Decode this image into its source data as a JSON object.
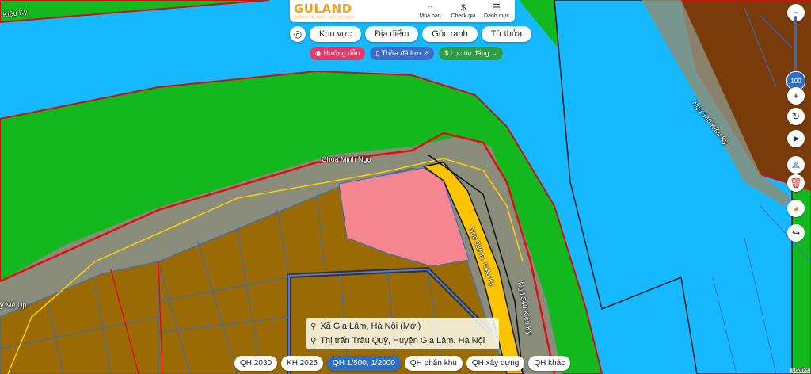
{
  "header": {
    "logo_text": "GULAND",
    "logo_sub": "THÔNG TIN THẬT · GIÁ TRỊ THẬT",
    "actions": [
      {
        "label": "Mua bán",
        "icon": "house-icon"
      },
      {
        "label": "Check giá",
        "icon": "dollar-icon"
      },
      {
        "label": "Danh mục",
        "icon": "menu-icon"
      }
    ]
  },
  "search_tabs": [
    "Khu vực",
    "Địa điểm",
    "Góc ranh",
    "Tờ thửa"
  ],
  "chips": {
    "guide": "Hướng dẫn",
    "saved": "Thửa đã lưu",
    "filter": "Lọc tin đăng"
  },
  "side": {
    "zoom_level": "100",
    "buttons": [
      "plus-icon",
      "refresh-icon",
      "navigate-icon",
      "measure-icon",
      "trash-icon",
      "palette-icon",
      "share-icon"
    ]
  },
  "map_labels": {
    "pagoda": "Chùa Minh Ngọ",
    "road_left": "Ngõ 340 Kiêu Kỵ",
    "road_right": "Ngõ 340 Kiêu Kỵ",
    "road_mid": "Ngõ 380 Đ. Kiêu Kỵ",
    "street_top_left": "Kiêu Kỵ",
    "street_left": "ỳ Mê Ụp"
  },
  "address": {
    "line1": "Xã Gia Lâm, Hà Nội (Mới)",
    "line2": "Thị trấn Trâu Quỳ, Huyện Gia Lâm, Hà Nội"
  },
  "bottom_tabs": [
    {
      "label": "QH 2030",
      "active": false
    },
    {
      "label": "KH 2025",
      "active": false
    },
    {
      "label": "QH 1/500, 1/2000",
      "active": true
    },
    {
      "label": "QH phân khu",
      "active": false
    },
    {
      "label": "QH xây dựng",
      "active": false
    },
    {
      "label": "QH khác",
      "active": false
    }
  ],
  "attribution": "Leaflet",
  "colors": {
    "water": "#16b8ff",
    "green": "#12b81e",
    "residential": "#9a6a05",
    "pink": "#f58690",
    "yellow": "#ffc400",
    "brown_dark": "#7a3b0a",
    "boundary_red": "#e01010",
    "accent_blue": "#2c6fc9"
  }
}
